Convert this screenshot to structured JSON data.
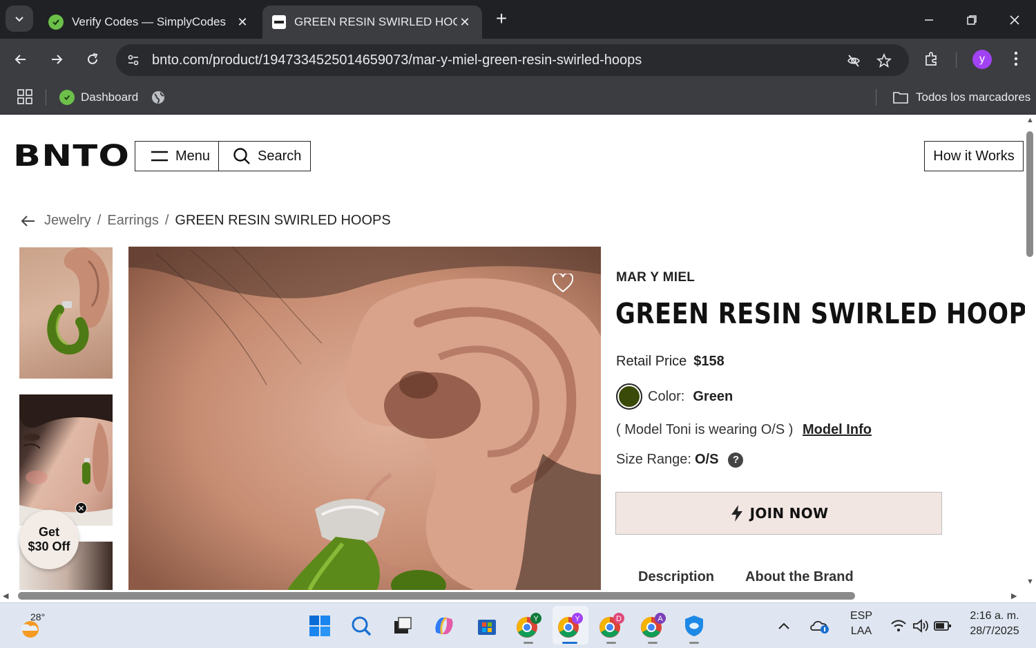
{
  "browser": {
    "tabs": [
      {
        "title": "Verify Codes — SimplyCodes",
        "active": false
      },
      {
        "title": "GREEN RESIN SWIRLED HOOPS",
        "active": true
      }
    ],
    "url": "bnto.com/product/1947334525014659073/mar-y-miel-green-resin-swirled-hoops",
    "profile_initial": "y",
    "bookmarks": [
      {
        "label": "Dashboard"
      }
    ],
    "all_bookmarks_label": "Todos los marcadores"
  },
  "site": {
    "logo": "BNTO",
    "menu_label": "Menu",
    "search_label": "Search",
    "how_it_works_label": "How it Works"
  },
  "breadcrumb": {
    "items": [
      "Jewelry",
      "Earrings"
    ],
    "current": "GREEN RESIN SWIRLED HOOPS",
    "separator": "/"
  },
  "product": {
    "brand": "MAR Y MIEL",
    "title": "GREEN RESIN SWIRLED HOOPS",
    "retail_price_label": "Retail Price",
    "retail_price": "$158",
    "color_label": "Color:",
    "color_value": "Green",
    "color_hex": "#3a4a08",
    "model_text": "( Model Toni is wearing O/S )",
    "model_info_link": "Model Info",
    "size_label": "Size Range:",
    "size_value": "O/S",
    "help_glyph": "?",
    "join_button": "JOIN NOW",
    "info_tabs": [
      "Description",
      "About the Brand"
    ]
  },
  "promo": {
    "line1": "Get",
    "line2": "$30 Off",
    "close_glyph": "✕"
  },
  "taskbar": {
    "temperature": "28°",
    "language_line1": "ESP",
    "language_line2": "LAA",
    "time": "2:16 a. m.",
    "date": "28/7/2025",
    "chrome_badges": [
      "Y",
      "Y",
      "D",
      "A"
    ]
  },
  "colors": {
    "accent_green": "#6cc04a",
    "join_bg": "#f2e6e3",
    "chrome_dark": "#202124",
    "chrome_mid": "#3c3d40"
  }
}
